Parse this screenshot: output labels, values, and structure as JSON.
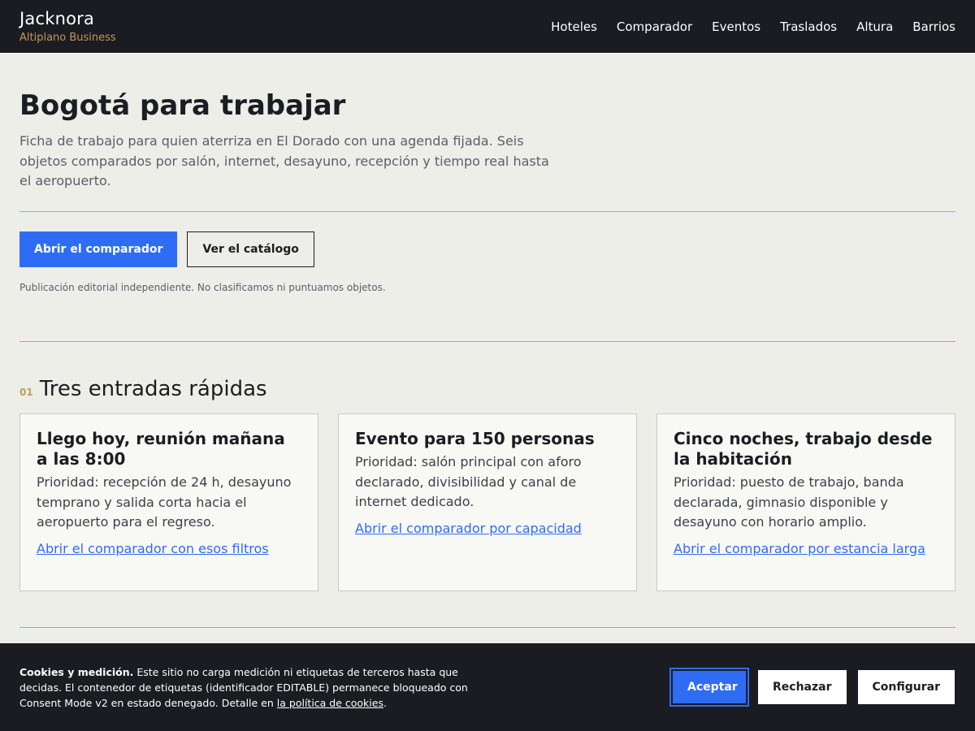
{
  "header": {
    "brand": "Jacknora",
    "tagline": "Altiplano Business",
    "nav": [
      "Hoteles",
      "Comparador",
      "Eventos",
      "Traslados",
      "Altura",
      "Barrios"
    ]
  },
  "hero": {
    "title": "Bogotá para trabajar",
    "lead": "Ficha de trabajo para quien aterriza en El Dorado con una agenda fijada. Seis objetos comparados por salón, internet, desayuno, recepción y tiempo real hasta el aeropuerto.",
    "primary_button": "Abrir el comparador",
    "secondary_button": "Ver el catálogo",
    "disclaimer": "Publicación editorial independiente. No clasificamos ni puntuamos objetos."
  },
  "section": {
    "number": "01",
    "title": "Tres entradas rápidas",
    "cards": [
      {
        "title": "Llego hoy, reunión mañana a las 8:00",
        "text": "Prioridad: recepción de 24 h, desayuno temprano y salida corta hacia el aeropuerto para el regreso.",
        "link": "Abrir el comparador con esos filtros"
      },
      {
        "title": "Evento para 150 personas",
        "text": "Prioridad: salón principal con aforo declarado, divisibilidad y canal de internet dedicado.",
        "link": "Abrir el comparador por capacidad"
      },
      {
        "title": "Cinco noches, trabajo desde la habitación",
        "text": "Prioridad: puesto de trabajo, banda declarada, gimnasio disponible y desayuno con horario amplio.",
        "link": "Abrir el comparador por estancia larga"
      }
    ]
  },
  "cookie": {
    "heading": "Cookies y medición.",
    "text": " Este sitio no carga medición ni etiquetas de terceros hasta que decidas. El contenedor de etiquetas (identificador EDITABLE) permanece bloqueado con Consent Mode v2 en estado denegado. Detalle en ",
    "link": "la política de cookies",
    "end": ".",
    "accept": "Aceptar",
    "reject": "Rechazar",
    "configure": "Configurar"
  }
}
